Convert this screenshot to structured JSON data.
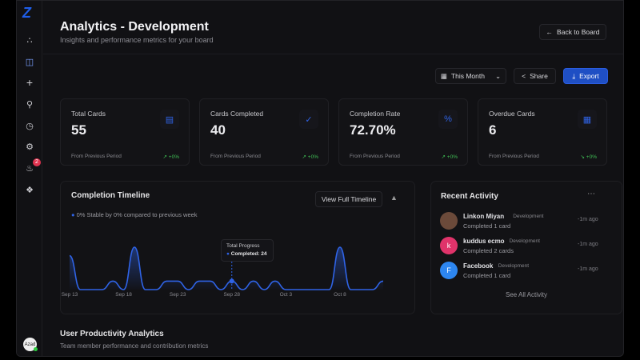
{
  "sidebar": {
    "logo": "Z",
    "notification_count": "2",
    "user_avatar": "Azad",
    "icons": [
      "team-icon",
      "board-icon",
      "plus-icon",
      "search-icon",
      "history-icon",
      "settings-icon",
      "bell-icon",
      "megaphone-icon"
    ]
  },
  "header": {
    "title": "Analytics - Development",
    "subtitle": "Insights and performance metrics for your board",
    "back_label": "Back to Board"
  },
  "toolbar": {
    "period": "This Month",
    "share": "Share",
    "export": "Export"
  },
  "stats": [
    {
      "label": "Total Cards",
      "value": "55",
      "icon": "clipboard-icon",
      "footer": "From Previous Period",
      "change": "+0%",
      "trend": "up"
    },
    {
      "label": "Cards Completed",
      "value": "40",
      "icon": "check-circle-icon",
      "footer": "From Previous Period",
      "change": "+0%",
      "trend": "up"
    },
    {
      "label": "Completion Rate",
      "value": "72.70%",
      "icon": "percent-icon",
      "footer": "From Previous Period",
      "change": "+0%",
      "trend": "up"
    },
    {
      "label": "Overdue Cards",
      "value": "6",
      "icon": "calendar-icon",
      "footer": "From Previous Period",
      "change": "+0%",
      "trend": "down"
    }
  ],
  "timeline": {
    "title": "Completion Timeline",
    "view_full": "View Full Timeline",
    "legend": "0% Stable by 0% compared to previous week",
    "tooltip_title": "Total Progress",
    "tooltip_value": "Completed: 24",
    "accent": "#2f63e6"
  },
  "chart_data": {
    "type": "area",
    "x": [
      "Sep 13",
      "Sep 14",
      "Sep 15",
      "Sep 16",
      "Sep 17",
      "Sep 18",
      "Sep 19",
      "Sep 20",
      "Sep 21",
      "Sep 22",
      "Sep 23",
      "Sep 24",
      "Sep 25",
      "Sep 26",
      "Sep 27",
      "Sep 28",
      "Sep 29",
      "Sep 30",
      "Oct 1",
      "Oct 2",
      "Oct 3",
      "Oct 4",
      "Oct 5",
      "Oct 6",
      "Oct 7",
      "Oct 8",
      "Oct 9",
      "Oct 10",
      "Oct 11",
      "Oct 12"
    ],
    "values": [
      4,
      0,
      0,
      0,
      1,
      0,
      5,
      0,
      0,
      1,
      1,
      0,
      1,
      1,
      0,
      1,
      0,
      1,
      0,
      1,
      0,
      0,
      0,
      0,
      0,
      5,
      0,
      0,
      0,
      1
    ],
    "tick_labels": [
      "Sep 13",
      "Sep 18",
      "Sep 23",
      "Sep 28",
      "Oct 3",
      "Oct 8"
    ],
    "grid": false
  },
  "activity": {
    "title": "Recent Activity",
    "see_all": "See All Activity",
    "items": [
      {
        "name": "Linkon Miyan",
        "tag": "Development",
        "desc": "Completed 1 card",
        "time": "-1m ago",
        "initial": "",
        "color": "#6b4a3a"
      },
      {
        "name": "kuddus ecmo",
        "tag": "Development",
        "desc": "Completed 2 cards",
        "time": "-1m ago",
        "initial": "k",
        "color": "#e0336a"
      },
      {
        "name": "Facebook",
        "tag": "Development",
        "desc": "Completed 1 card",
        "time": "-1m ago",
        "initial": "F",
        "color": "#2d86f0"
      }
    ]
  },
  "productivity": {
    "title": "User Productivity Analytics",
    "subtitle": "Team member performance and contribution metrics"
  }
}
